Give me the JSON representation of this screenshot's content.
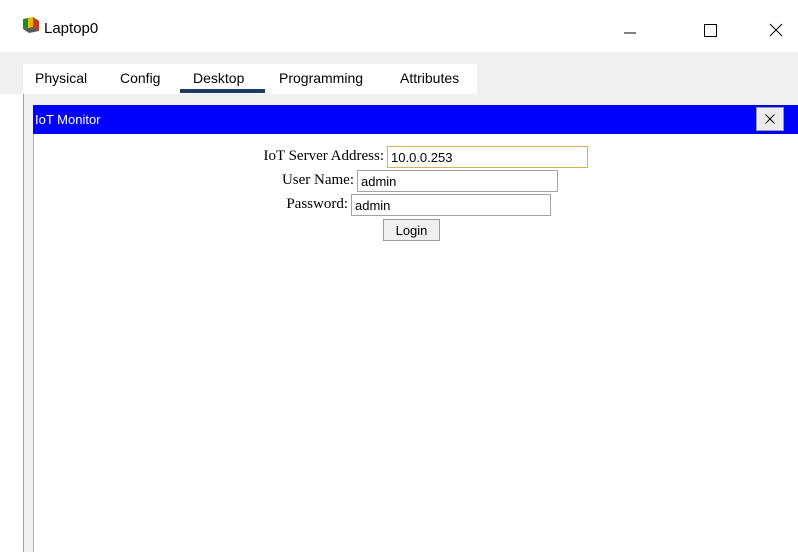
{
  "window": {
    "title": "Laptop0",
    "app_icon": "laptop-device-icon",
    "controls": [
      "minimize-icon",
      "maximize-icon",
      "close-icon"
    ]
  },
  "tabs": [
    {
      "label": "Physical",
      "active": false
    },
    {
      "label": "Config",
      "active": false
    },
    {
      "label": "Desktop",
      "active": true
    },
    {
      "label": "Programming",
      "active": false
    },
    {
      "label": "Attributes",
      "active": false
    }
  ],
  "iot_monitor": {
    "title": "IoT Monitor",
    "header_color": "#0000ff",
    "close_icon": "close-icon"
  },
  "login_form": {
    "server_label": "IoT Server Address:",
    "server_value": "10.0.0.253",
    "username_label": "User Name:",
    "username_value": "admin",
    "password_label": "Password:",
    "password_value": "admin",
    "login_label": "Login"
  }
}
